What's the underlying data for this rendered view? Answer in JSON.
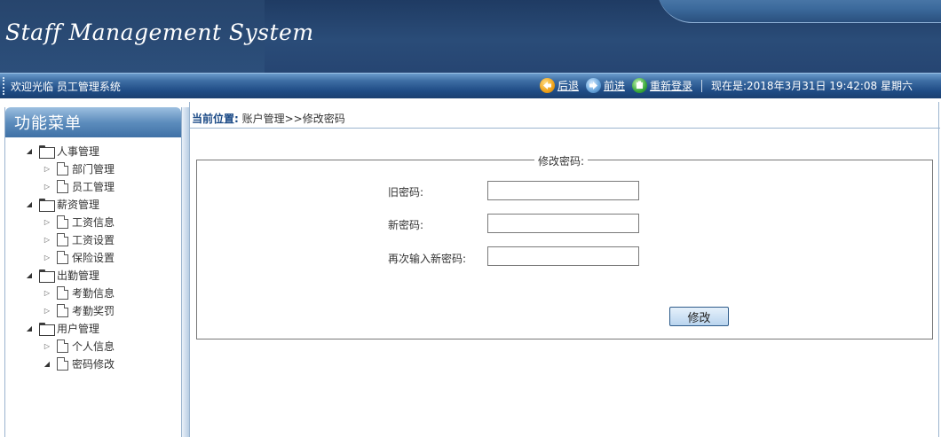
{
  "header": {
    "title": "Staff Management System"
  },
  "toolbar": {
    "welcome": "欢迎光临 员工管理系统",
    "back_label": "后退",
    "forward_label": "前进",
    "relogin_label": "重新登录",
    "now_text": "现在是:2018年3月31日 19:42:08 星期六"
  },
  "menu": {
    "title": "功能菜单",
    "groups": [
      {
        "label": "人事管理",
        "items": [
          {
            "label": "部门管理"
          },
          {
            "label": "员工管理"
          }
        ]
      },
      {
        "label": "薪资管理",
        "items": [
          {
            "label": "工资信息"
          },
          {
            "label": "工资设置"
          },
          {
            "label": "保险设置"
          }
        ]
      },
      {
        "label": "出勤管理",
        "items": [
          {
            "label": "考勤信息"
          },
          {
            "label": "考勤奖罚"
          }
        ]
      },
      {
        "label": "用户管理",
        "items": [
          {
            "label": "个人信息"
          },
          {
            "label": "密码修改"
          }
        ]
      }
    ]
  },
  "breadcrumb": {
    "label": "当前位置:",
    "path": " 账户管理>>修改密码"
  },
  "form": {
    "legend": "修改密码:",
    "old_password_label": "旧密码:",
    "old_password_value": "",
    "new_password_label": "新密码:",
    "new_password_value": "",
    "confirm_password_label": "再次输入新密码:",
    "confirm_password_value": "",
    "submit_label": "修改"
  }
}
